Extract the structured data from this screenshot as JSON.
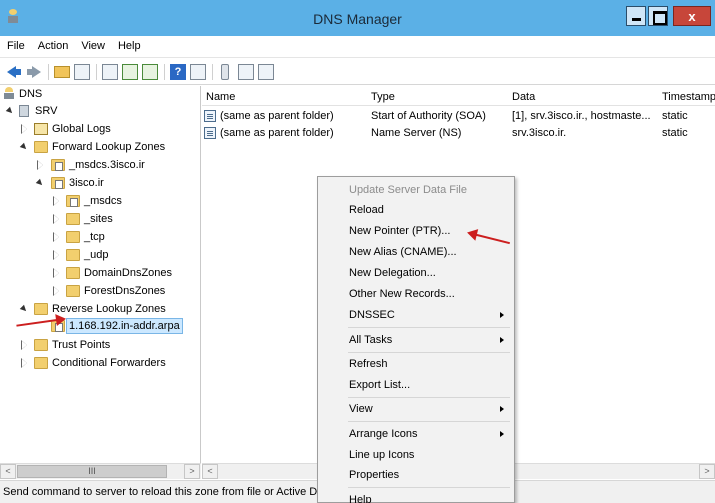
{
  "window": {
    "title": "DNS Manager"
  },
  "menubar": [
    "File",
    "Action",
    "View",
    "Help"
  ],
  "toolbar": {
    "icons": [
      "back-arrow-icon",
      "forward-arrow-icon",
      "up-folder-icon",
      "show-tree-icon",
      "properties-icon",
      "refresh-icon",
      "export-list-icon",
      "help-icon",
      "show-hide-icon",
      "server-icon",
      "zone-icon",
      "record-icon"
    ]
  },
  "tree": {
    "dns": "DNS",
    "srv": "SRV",
    "global_logs": "Global Logs",
    "forward_lookup_zones": "Forward Lookup Zones",
    "msdcs_zone": "_msdcs.3isco.ir",
    "zone_3isco": "3isco.ir",
    "msdcs": "_msdcs",
    "sites": "_sites",
    "tcp": "_tcp",
    "udp": "_udp",
    "domain_dns_zones": "DomainDnsZones",
    "forest_dns_zones": "ForestDnsZones",
    "reverse_lookup_zones": "Reverse Lookup Zones",
    "reverse_zone": "1.168.192.in-addr.arpa",
    "trust_points": "Trust Points",
    "conditional_forwarders": "Conditional Forwarders"
  },
  "list": {
    "columns": [
      "Name",
      "Type",
      "Data",
      "Timestamp"
    ],
    "rows": [
      {
        "name": "(same as parent folder)",
        "type": "Start of Authority (SOA)",
        "data": "[1], srv.3isco.ir., hostmaste...",
        "timestamp": "static"
      },
      {
        "name": "(same as parent folder)",
        "type": "Name Server (NS)",
        "data": "srv.3isco.ir.",
        "timestamp": "static"
      }
    ]
  },
  "context_menu": {
    "items": [
      "Update Server Data File",
      "Reload",
      "New Pointer (PTR)...",
      "New Alias (CNAME)...",
      "New Delegation...",
      "Other New Records...",
      "DNSSEC",
      "All Tasks",
      "Refresh",
      "Export List...",
      "View",
      "Arrange Icons",
      "Line up Icons",
      "Properties",
      "Help"
    ]
  },
  "scrollbar": {
    "thumb_glyph": "III",
    "left_glyph": "<",
    "right_glyph": ">"
  },
  "status": {
    "text": "Send command to server to reload this zone from file or Active Directory"
  },
  "colors": {
    "titlebar": "#5bb0e6",
    "selection": "#cce8ff",
    "annotation": "#cc1f1f"
  }
}
